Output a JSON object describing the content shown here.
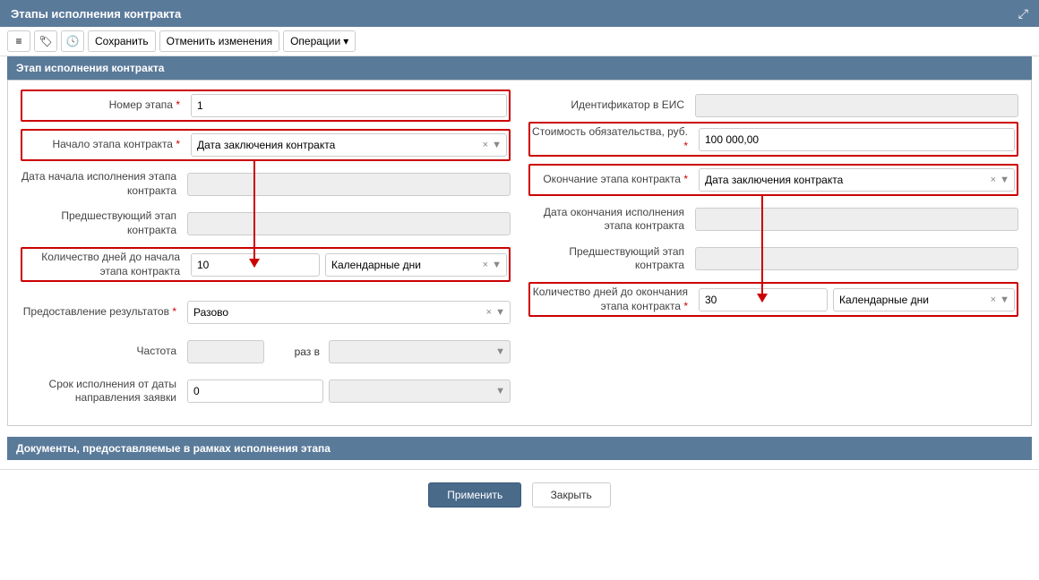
{
  "header": {
    "title": "Этапы исполнения контракта"
  },
  "toolbar": {
    "save": "Сохранить",
    "cancel": "Отменить изменения",
    "operations": "Операции"
  },
  "section1": "Этап исполнения контракта",
  "section2": "Документы, предоставляемые в рамках исполнения этапа",
  "left": {
    "stage_num_label": "Номер этапа",
    "stage_num_value": "1",
    "start_label": "Начало этапа контракта",
    "start_value": "Дата заключения контракта",
    "start_date_label": "Дата начала исполнения этапа контракта",
    "prev_label": "Предшествующий этап контракта",
    "days_start_label": "Количество дней до начала этапа контракта",
    "days_start_value": "10",
    "days_type": "Календарные дни",
    "results_label": "Предоставление результатов",
    "results_value": "Разово",
    "freq_label": "Частота",
    "freq_mid": "раз в",
    "deadline_label": "Срок исполнения от даты направления заявки",
    "deadline_value": "0"
  },
  "right": {
    "eis_label": "Идентификатор в ЕИС",
    "cost_label": "Стоимость обязательства, руб.",
    "cost_value": "100 000,00",
    "end_label": "Окончание этапа контракта",
    "end_value": "Дата заключения контракта",
    "end_date_label": "Дата окончания исполнения этапа контракта",
    "prev_label": "Предшествующий этап контракта",
    "days_end_label": "Количество дней до окончания этапа контракта",
    "days_end_value": "30",
    "days_type": "Календарные дни"
  },
  "footer": {
    "apply": "Применить",
    "close": "Закрыть"
  }
}
